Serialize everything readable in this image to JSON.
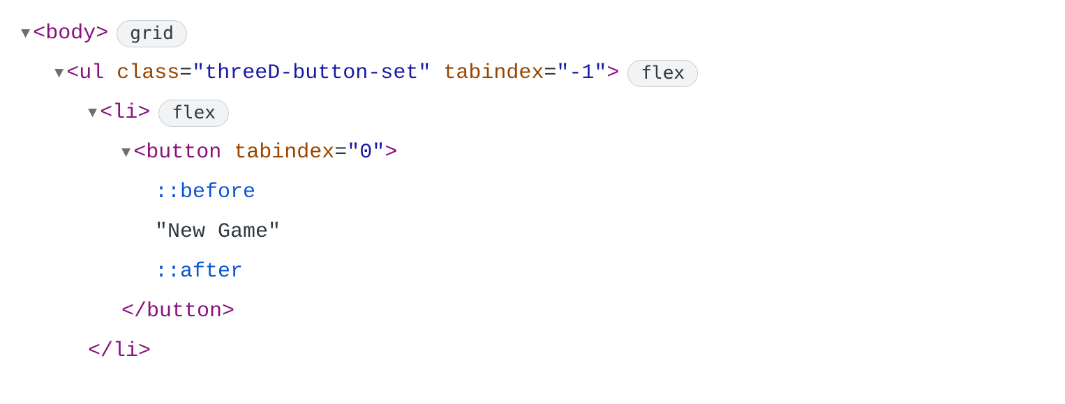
{
  "lines": [
    {
      "level": 0,
      "triangle": true,
      "parts": [
        {
          "kind": "bracket",
          "text": "<"
        },
        {
          "kind": "tagname",
          "text": "body"
        },
        {
          "kind": "bracket",
          "text": ">"
        }
      ],
      "badge": "grid"
    },
    {
      "level": 1,
      "triangle": true,
      "parts": [
        {
          "kind": "bracket",
          "text": "<"
        },
        {
          "kind": "tagname",
          "text": "ul"
        },
        {
          "kind": "space"
        },
        {
          "kind": "attrname",
          "text": "class"
        },
        {
          "kind": "eq",
          "text": "="
        },
        {
          "kind": "attrvalue",
          "text": "\"threeD-button-set\""
        },
        {
          "kind": "space"
        },
        {
          "kind": "attrname",
          "text": "tabindex"
        },
        {
          "kind": "eq",
          "text": "="
        },
        {
          "kind": "attrvalue",
          "text": "\"-1\""
        },
        {
          "kind": "bracket",
          "text": ">"
        }
      ],
      "badge": "flex"
    },
    {
      "level": 2,
      "triangle": true,
      "parts": [
        {
          "kind": "bracket",
          "text": "<"
        },
        {
          "kind": "tagname",
          "text": "li"
        },
        {
          "kind": "bracket",
          "text": ">"
        }
      ],
      "badge": "flex"
    },
    {
      "level": 3,
      "triangle": true,
      "parts": [
        {
          "kind": "bracket",
          "text": "<"
        },
        {
          "kind": "tagname",
          "text": "button"
        },
        {
          "kind": "space"
        },
        {
          "kind": "attrname",
          "text": "tabindex"
        },
        {
          "kind": "eq",
          "text": "="
        },
        {
          "kind": "attrvalue",
          "text": "\"0\""
        },
        {
          "kind": "bracket",
          "text": ">"
        }
      ]
    },
    {
      "level": 4,
      "parts": [
        {
          "kind": "pseudo",
          "text": "::before"
        }
      ]
    },
    {
      "level": 4,
      "parts": [
        {
          "kind": "textnode",
          "text": "\"New Game\""
        }
      ]
    },
    {
      "level": 4,
      "parts": [
        {
          "kind": "pseudo",
          "text": "::after"
        }
      ]
    },
    {
      "level": 3,
      "parts": [
        {
          "kind": "bracket",
          "text": "</"
        },
        {
          "kind": "tagname",
          "text": "button"
        },
        {
          "kind": "bracket",
          "text": ">"
        }
      ]
    },
    {
      "level": 2,
      "parts": [
        {
          "kind": "bracket",
          "text": "</"
        },
        {
          "kind": "tagname",
          "text": "li"
        },
        {
          "kind": "bracket",
          "text": ">"
        }
      ]
    }
  ]
}
